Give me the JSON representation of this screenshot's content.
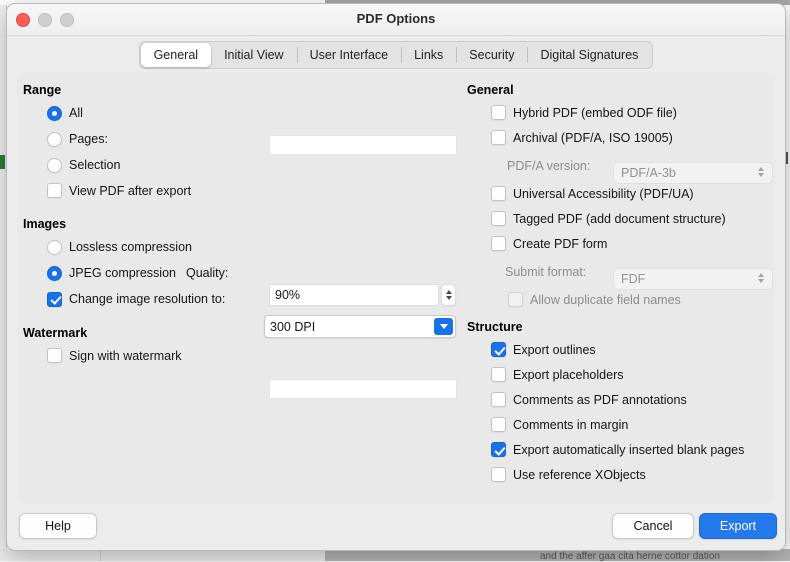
{
  "window": {
    "title": "PDF Options",
    "traffic_lights": [
      "close",
      "minimize",
      "maximize"
    ]
  },
  "tabs": [
    {
      "label": "General",
      "active": true
    },
    {
      "label": "Initial View",
      "active": false
    },
    {
      "label": "User Interface",
      "active": false
    },
    {
      "label": "Links",
      "active": false
    },
    {
      "label": "Security",
      "active": false
    },
    {
      "label": "Digital Signatures",
      "active": false
    }
  ],
  "left": {
    "range": {
      "title": "Range",
      "all": {
        "label": "All",
        "checked": true
      },
      "pages": {
        "label": "Pages:",
        "checked": false,
        "value": "",
        "placeholder": ""
      },
      "selection": {
        "label": "Selection",
        "checked": false
      },
      "view_after_export": {
        "label": "View PDF after export",
        "checked": false
      }
    },
    "images": {
      "title": "Images",
      "lossless": {
        "label": "Lossless compression",
        "checked": false
      },
      "jpeg": {
        "label": "JPEG compression",
        "checked": true
      },
      "quality_label": "Quality:",
      "quality_value": "90%",
      "resolution": {
        "label": "Change image resolution to:",
        "checked": true
      },
      "resolution_value": "300 DPI"
    },
    "watermark": {
      "title": "Watermark",
      "sign": {
        "label": "Sign with watermark",
        "checked": false
      },
      "value": "",
      "placeholder": ""
    }
  },
  "right": {
    "general": {
      "title": "General",
      "hybrid": {
        "label": "Hybrid PDF (embed ODF file)",
        "checked": false
      },
      "archival": {
        "label": "Archival (PDF/A, ISO 19005)",
        "checked": false
      },
      "pdfa_version_label": "PDF/A version:",
      "pdfa_version_value": "PDF/A-3b",
      "universal_accessibility": {
        "label": "Universal Accessibility (PDF/UA)",
        "checked": false
      },
      "tagged": {
        "label": "Tagged PDF (add document structure)",
        "checked": false
      },
      "create_form": {
        "label": "Create PDF form",
        "checked": false
      },
      "submit_format_label": "Submit format:",
      "submit_format_value": "FDF",
      "allow_duplicate": {
        "label": "Allow duplicate field names",
        "checked": false
      }
    },
    "structure": {
      "title": "Structure",
      "items": [
        {
          "label": "Export outlines",
          "checked": true
        },
        {
          "label": "Export placeholders",
          "checked": false
        },
        {
          "label": "Comments as PDF annotations",
          "checked": false
        },
        {
          "label": "Comments in margin",
          "checked": false
        },
        {
          "label": "Export automatically inserted blank pages",
          "checked": true
        },
        {
          "label": "Use reference XObjects",
          "checked": false
        }
      ]
    }
  },
  "footer": {
    "help": "Help",
    "cancel": "Cancel",
    "export": "Export"
  },
  "colors": {
    "accent": "#1a72e8",
    "primary_button": "#2479ed",
    "close_light": "#ff5f57",
    "window_bg": "#ececec",
    "content_bg": "#e9e9e9"
  },
  "background": {
    "partial_text": "and the affer gaa cita herne cottor dation"
  }
}
